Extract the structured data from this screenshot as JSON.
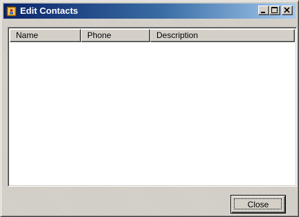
{
  "window": {
    "title": "Edit Contacts",
    "controls": {
      "minimize_icon": "minimize-icon",
      "maximize_icon": "maximize-icon",
      "close_icon": "close-icon"
    }
  },
  "contacts_list": {
    "columns": [
      "Name",
      "Phone",
      "Description"
    ],
    "rows": []
  },
  "footer": {
    "close_label": "Close"
  },
  "colors": {
    "titlebar_start": "#0a246a",
    "titlebar_end": "#a6caf0",
    "face": "#d4d0c8"
  }
}
